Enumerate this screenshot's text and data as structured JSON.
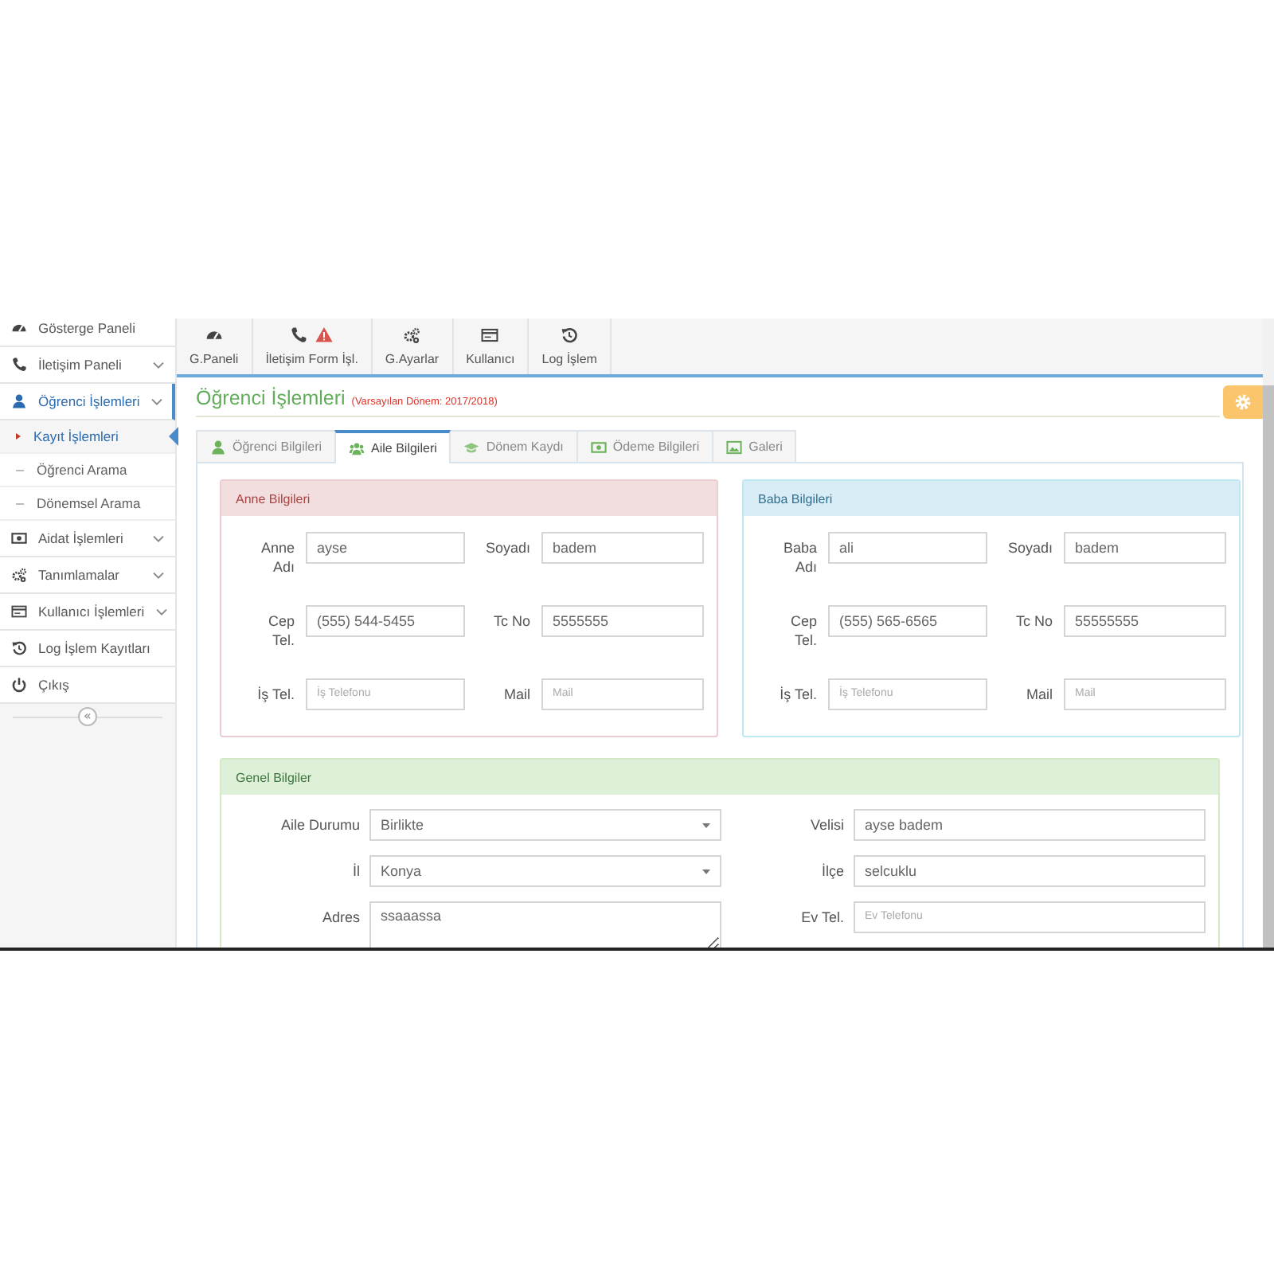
{
  "sidebar": {
    "items": [
      {
        "label": "Gösterge Paneli",
        "selected": false
      },
      {
        "label": "İletişim Paneli",
        "selected": false,
        "has_submenu": true
      },
      {
        "label": "Öğrenci İşlemleri",
        "selected": true,
        "has_submenu": true,
        "children": [
          {
            "label": "Kayıt İşlemleri",
            "selected": true
          },
          {
            "label": "Öğrenci Arama",
            "selected": false
          },
          {
            "label": "Dönemsel Arama",
            "selected": false
          }
        ]
      },
      {
        "label": "Aidat İşlemleri",
        "selected": false,
        "has_submenu": true
      },
      {
        "label": "Tanımlamalar",
        "selected": false,
        "has_submenu": true
      },
      {
        "label": "Kullanıcı İşlemleri",
        "selected": false,
        "has_submenu": true
      },
      {
        "label": "Log İşlem Kayıtları",
        "selected": false
      },
      {
        "label": "Çıkış",
        "selected": false
      }
    ],
    "collapse_button": "«"
  },
  "toolbar": [
    {
      "label": "G.Paneli",
      "warning": false
    },
    {
      "label": "İletişim Form İşl.",
      "warning": true
    },
    {
      "label": "G.Ayarlar",
      "warning": false
    },
    {
      "label": "Kullanıcı",
      "warning": false
    },
    {
      "label": "Log İşlem",
      "warning": false
    }
  ],
  "header": {
    "title": "Öğrenci İşlemleri",
    "subtitle": "(Varsayılan Dönem: 2017/2018)"
  },
  "tabs": [
    {
      "label": "Öğrenci Bilgileri",
      "selected": false
    },
    {
      "label": "Aile Bilgileri",
      "selected": true
    },
    {
      "label": "Dönem Kaydı",
      "selected": false
    },
    {
      "label": "Ödeme Bilgileri",
      "selected": false
    },
    {
      "label": "Galeri",
      "selected": false
    }
  ],
  "parent_panels": [
    {
      "title": "Anne Bilgileri",
      "kind": "danger",
      "fields": [
        {
          "label": "Anne Adı",
          "value": "ayse"
        },
        {
          "label": "Soyadı",
          "value": "badem"
        },
        {
          "label": "Cep Tel.",
          "value": "(555) 544-5455"
        },
        {
          "label": "Tc No",
          "value": "5555555"
        },
        {
          "label": "İş Tel.",
          "placeholder": "İş Telefonu"
        },
        {
          "label": "Mail",
          "placeholder": "Mail"
        }
      ]
    },
    {
      "title": "Baba Bilgileri",
      "kind": "info",
      "fields": [
        {
          "label": "Baba Adı",
          "value": "ali"
        },
        {
          "label": "Soyadı",
          "value": "badem"
        },
        {
          "label": "Cep Tel.",
          "value": "(555) 565-6565"
        },
        {
          "label": "Tc No",
          "value": "55555555"
        },
        {
          "label": "İş Tel.",
          "placeholder": "İş Telefonu"
        },
        {
          "label": "Mail",
          "placeholder": "Mail"
        }
      ]
    }
  ],
  "general_panel": {
    "title": "Genel Bilgiler",
    "kind": "success",
    "fields": [
      {
        "label": "Aile Durumu",
        "kind": "select",
        "value": "Birlikte"
      },
      {
        "label": "Velisi",
        "kind": "text",
        "value": "ayse badem"
      },
      {
        "label": "İl",
        "kind": "select",
        "value": "Konya"
      },
      {
        "label": "İlçe",
        "kind": "text",
        "value": "selcuklu"
      },
      {
        "label": "Adres",
        "kind": "textarea",
        "value": "ssaaassa"
      },
      {
        "label": "Ev Tel.",
        "kind": "text",
        "placeholder": "Ev Telefonu"
      }
    ]
  }
}
